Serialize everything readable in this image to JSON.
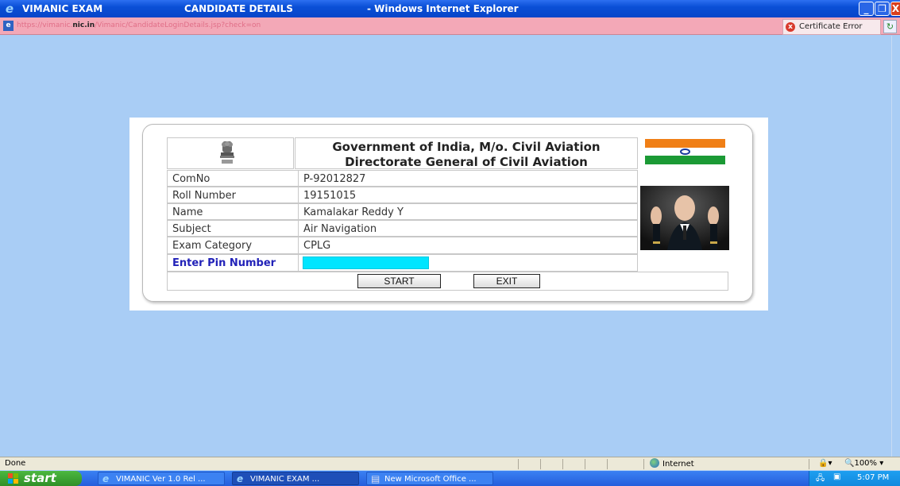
{
  "window": {
    "title_app": "VIMANIC EXAM",
    "title_page": "CANDIDATE DETAILS",
    "title_browser": "- Windows Internet Explorer"
  },
  "address_bar": {
    "url_prefix": "https://vimanic.",
    "url_domain": "nic.in",
    "url_path": "/Vimanic/CandidateLoginDetails.jsp?check=on",
    "certificate_error": "Certificate Error"
  },
  "form": {
    "heading_line1": "Government of India, M/o. Civil Aviation",
    "heading_line2": "Directorate General of Civil Aviation",
    "fields": [
      {
        "label": "ComNo",
        "value": "P-92012827"
      },
      {
        "label": "Roll Number",
        "value": "19151015"
      },
      {
        "label": "Name",
        "value": "Kamalakar Reddy Y"
      },
      {
        "label": "Subject",
        "value": "Air Navigation"
      },
      {
        "label": "Exam Category",
        "value": "CPLG"
      }
    ],
    "pin_label": "Enter Pin Number",
    "pin_value": "",
    "start_label": "START",
    "exit_label": "EXIT",
    "colors": {
      "pin_label": "#2222b8",
      "pin_input": "#00e5ff",
      "saffron": "#f07f16",
      "green": "#1b9a35",
      "chakra": "#1a3a9c"
    }
  },
  "status_bar": {
    "status": "Done",
    "zone": "Internet",
    "zoom": "100%"
  },
  "taskbar": {
    "start": "start",
    "tasks": [
      "VIMANIC Ver 1.0 Rel ...",
      "VIMANIC EXAM     ...",
      "New Microsoft Office ..."
    ],
    "clock": "5:07 PM"
  }
}
